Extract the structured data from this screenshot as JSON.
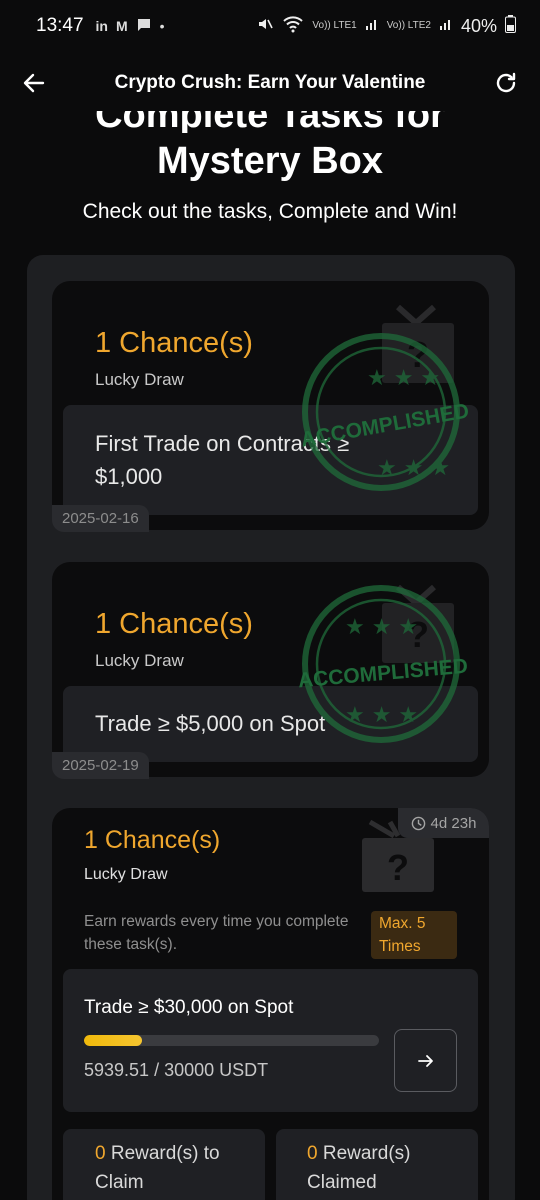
{
  "status_bar": {
    "time": "13:47",
    "left_icons": [
      "in",
      "M",
      "message-icon",
      "•"
    ],
    "battery": "40%",
    "lte1": "Vo)) LTE1",
    "lte2": "Vo)) LTE2"
  },
  "header": {
    "title": "Crypto Crush: Earn Your Valentine"
  },
  "hero": {
    "title_line1": "Complete Tasks for",
    "title_line2": "Mystery Box",
    "subtitle": "Check out the tasks, Complete and Win!"
  },
  "tasks": [
    {
      "chances": "1 Chance(s)",
      "label": "Lucky Draw",
      "task": "First Trade on Contracts ≥ $1,000",
      "date": "2025-02-16",
      "stamp": "ACCOMPLISHED"
    },
    {
      "chances": "1 Chance(s)",
      "label": "Lucky Draw",
      "task": "Trade ≥ $5,000 on Spot",
      "date": "2025-02-19",
      "stamp": "ACCOMPLISHED"
    },
    {
      "chances": "1 Chance(s)",
      "label": "Lucky Draw",
      "timer": "4d 23h",
      "earn_text": "Earn rewards every time you complete these task(s).",
      "max_badge": "Max. 5 Times",
      "task": "Trade ≥ $30,000 on Spot",
      "progress_text": "5939.51 / 30000 USDT",
      "progress_fraction": 0.198,
      "reward_claim_count": "0",
      "reward_claim_label": "Reward(s) to Claim",
      "reward_claimed_count": "0",
      "reward_claimed_label": "Reward(s) Claimed"
    }
  ],
  "colors": {
    "accent": "#f0a72e",
    "stamp_green": "#1f6b3a",
    "progress": "#f0b90b"
  }
}
